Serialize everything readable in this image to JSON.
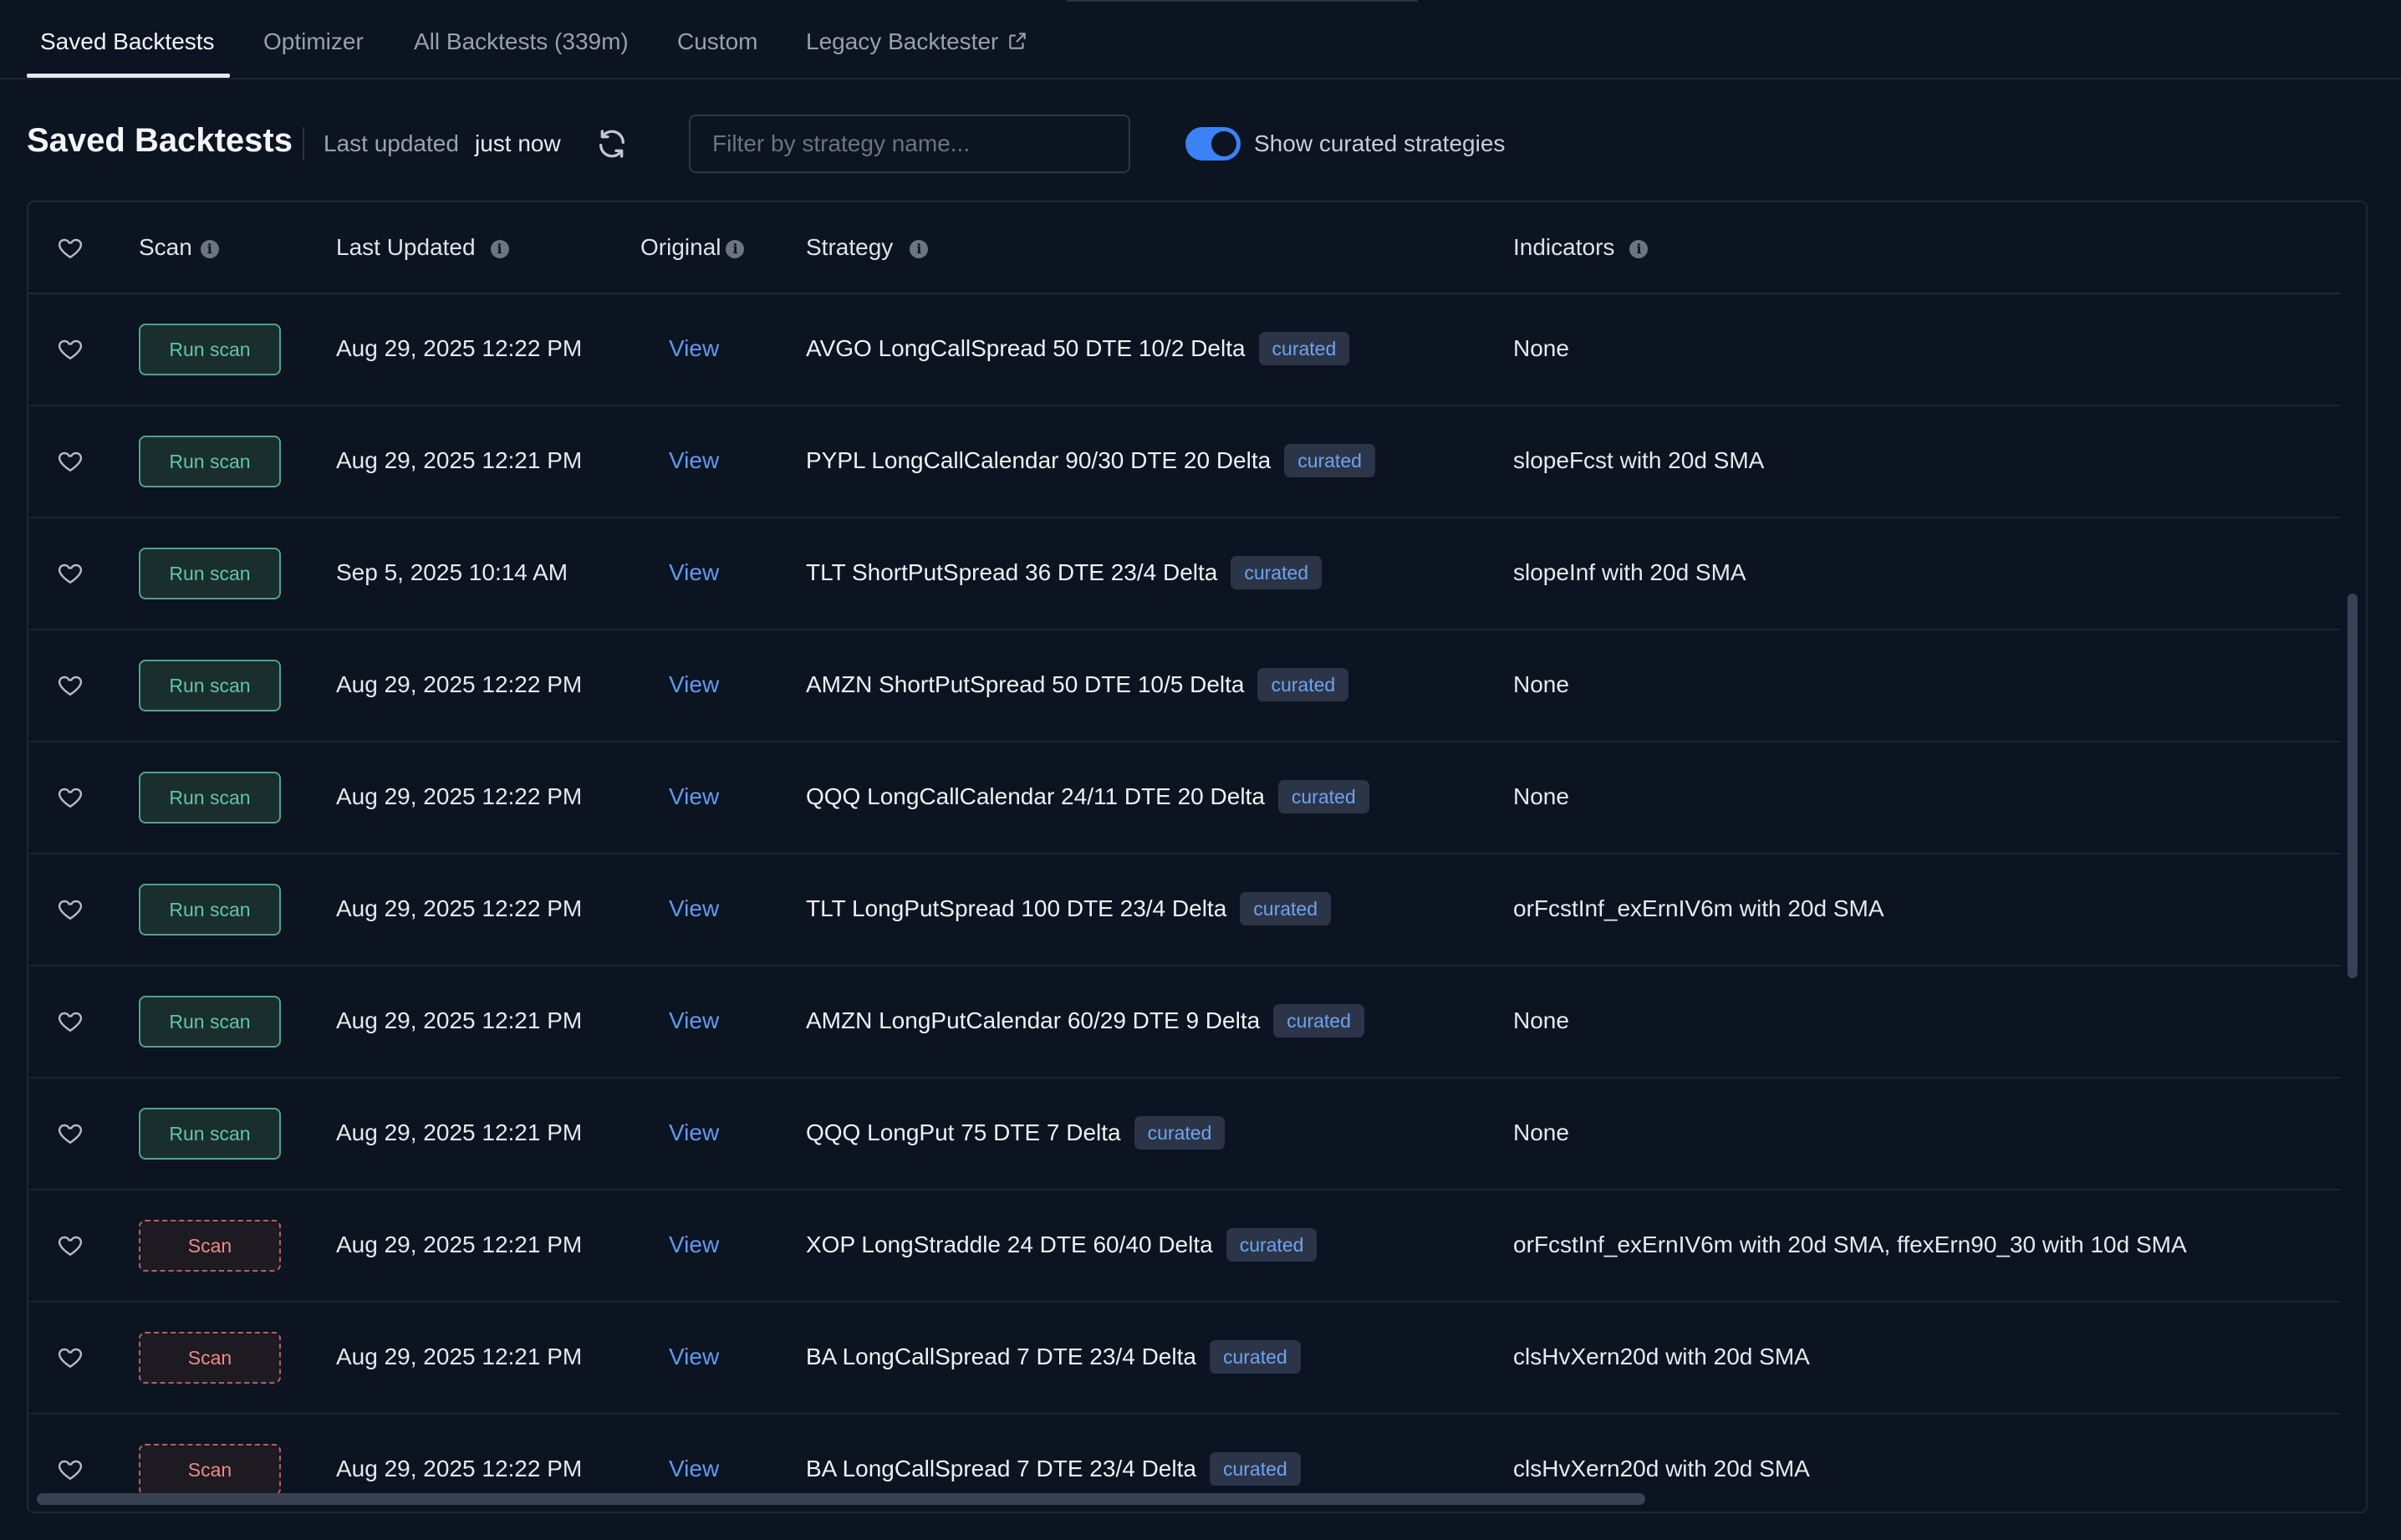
{
  "tabs": [
    {
      "label": "Saved Backtests",
      "active": true
    },
    {
      "label": "Optimizer"
    },
    {
      "label": "All Backtests (339m)"
    },
    {
      "label": "Custom"
    },
    {
      "label": "Legacy Backtester",
      "icon": "external-link-icon"
    }
  ],
  "header": {
    "title": "Saved Backtests",
    "last_updated_label": "Last updated",
    "last_updated_value": "just now",
    "refresh_icon": "refresh-icon",
    "filter_placeholder": "Filter by strategy name...",
    "filter_value": "",
    "toggle_label": "Show curated strategies",
    "toggle_on": true
  },
  "table": {
    "columns": [
      "Scan",
      "Last Updated",
      "Original",
      "Strategy",
      "Indicators"
    ],
    "rows": [
      {
        "scan": "Run scan",
        "scan_type": "run",
        "date": "Aug 29, 2025 12:22 PM",
        "original": "View",
        "strategy": "AVGO LongCallSpread 50 DTE 10/2 Delta",
        "badge": "curated",
        "indicators": "None"
      },
      {
        "scan": "Run scan",
        "scan_type": "run",
        "date": "Aug 29, 2025 12:21 PM",
        "original": "View",
        "strategy": "PYPL LongCallCalendar 90/30 DTE 20 Delta",
        "badge": "curated",
        "indicators": "slopeFcst with 20d SMA"
      },
      {
        "scan": "Run scan",
        "scan_type": "run",
        "date": "Sep 5, 2025 10:14 AM",
        "original": "View",
        "strategy": "TLT ShortPutSpread 36 DTE 23/4 Delta",
        "badge": "curated",
        "indicators": "slopeInf with 20d SMA"
      },
      {
        "scan": "Run scan",
        "scan_type": "run",
        "date": "Aug 29, 2025 12:22 PM",
        "original": "View",
        "strategy": "AMZN ShortPutSpread 50 DTE 10/5 Delta",
        "badge": "curated",
        "indicators": "None"
      },
      {
        "scan": "Run scan",
        "scan_type": "run",
        "date": "Aug 29, 2025 12:22 PM",
        "original": "View",
        "strategy": "QQQ LongCallCalendar 24/11 DTE 20 Delta",
        "badge": "curated",
        "indicators": "None"
      },
      {
        "scan": "Run scan",
        "scan_type": "run",
        "date": "Aug 29, 2025 12:22 PM",
        "original": "View",
        "strategy": "TLT LongPutSpread 100 DTE 23/4 Delta",
        "badge": "curated",
        "indicators": "orFcstInf_exErnIV6m with 20d SMA"
      },
      {
        "scan": "Run scan",
        "scan_type": "run",
        "date": "Aug 29, 2025 12:21 PM",
        "original": "View",
        "strategy": "AMZN LongPutCalendar 60/29 DTE 9 Delta",
        "badge": "curated",
        "indicators": "None"
      },
      {
        "scan": "Run scan",
        "scan_type": "run",
        "date": "Aug 29, 2025 12:21 PM",
        "original": "View",
        "strategy": "QQQ LongPut 75 DTE 7 Delta",
        "badge": "curated",
        "indicators": "None"
      },
      {
        "scan": "Scan",
        "scan_type": "scan",
        "date": "Aug 29, 2025 12:21 PM",
        "original": "View",
        "strategy": "XOP LongStraddle 24 DTE 60/40 Delta",
        "badge": "curated",
        "indicators": "orFcstInf_exErnIV6m with 20d SMA, ffexErn90_30 with 10d SMA"
      },
      {
        "scan": "Scan",
        "scan_type": "scan",
        "date": "Aug 29, 2025 12:21 PM",
        "original": "View",
        "strategy": "BA LongCallSpread 7 DTE 23/4 Delta",
        "badge": "curated",
        "indicators": "clsHvXern20d with 20d SMA"
      },
      {
        "scan": "Scan",
        "scan_type": "scan",
        "date": "Aug 29, 2025 12:22 PM",
        "original": "View",
        "strategy": "BA LongCallSpread 7 DTE 23/4 Delta",
        "badge": "curated",
        "indicators": "clsHvXern20d with 20d SMA"
      }
    ]
  },
  "colors": {
    "background": "#0c1321",
    "accent": "#3b82f6",
    "link": "#5c9bf0",
    "run_scan": "#62c6a2",
    "scan": "#ef8a84",
    "badge_text": "#6ea3f0"
  }
}
